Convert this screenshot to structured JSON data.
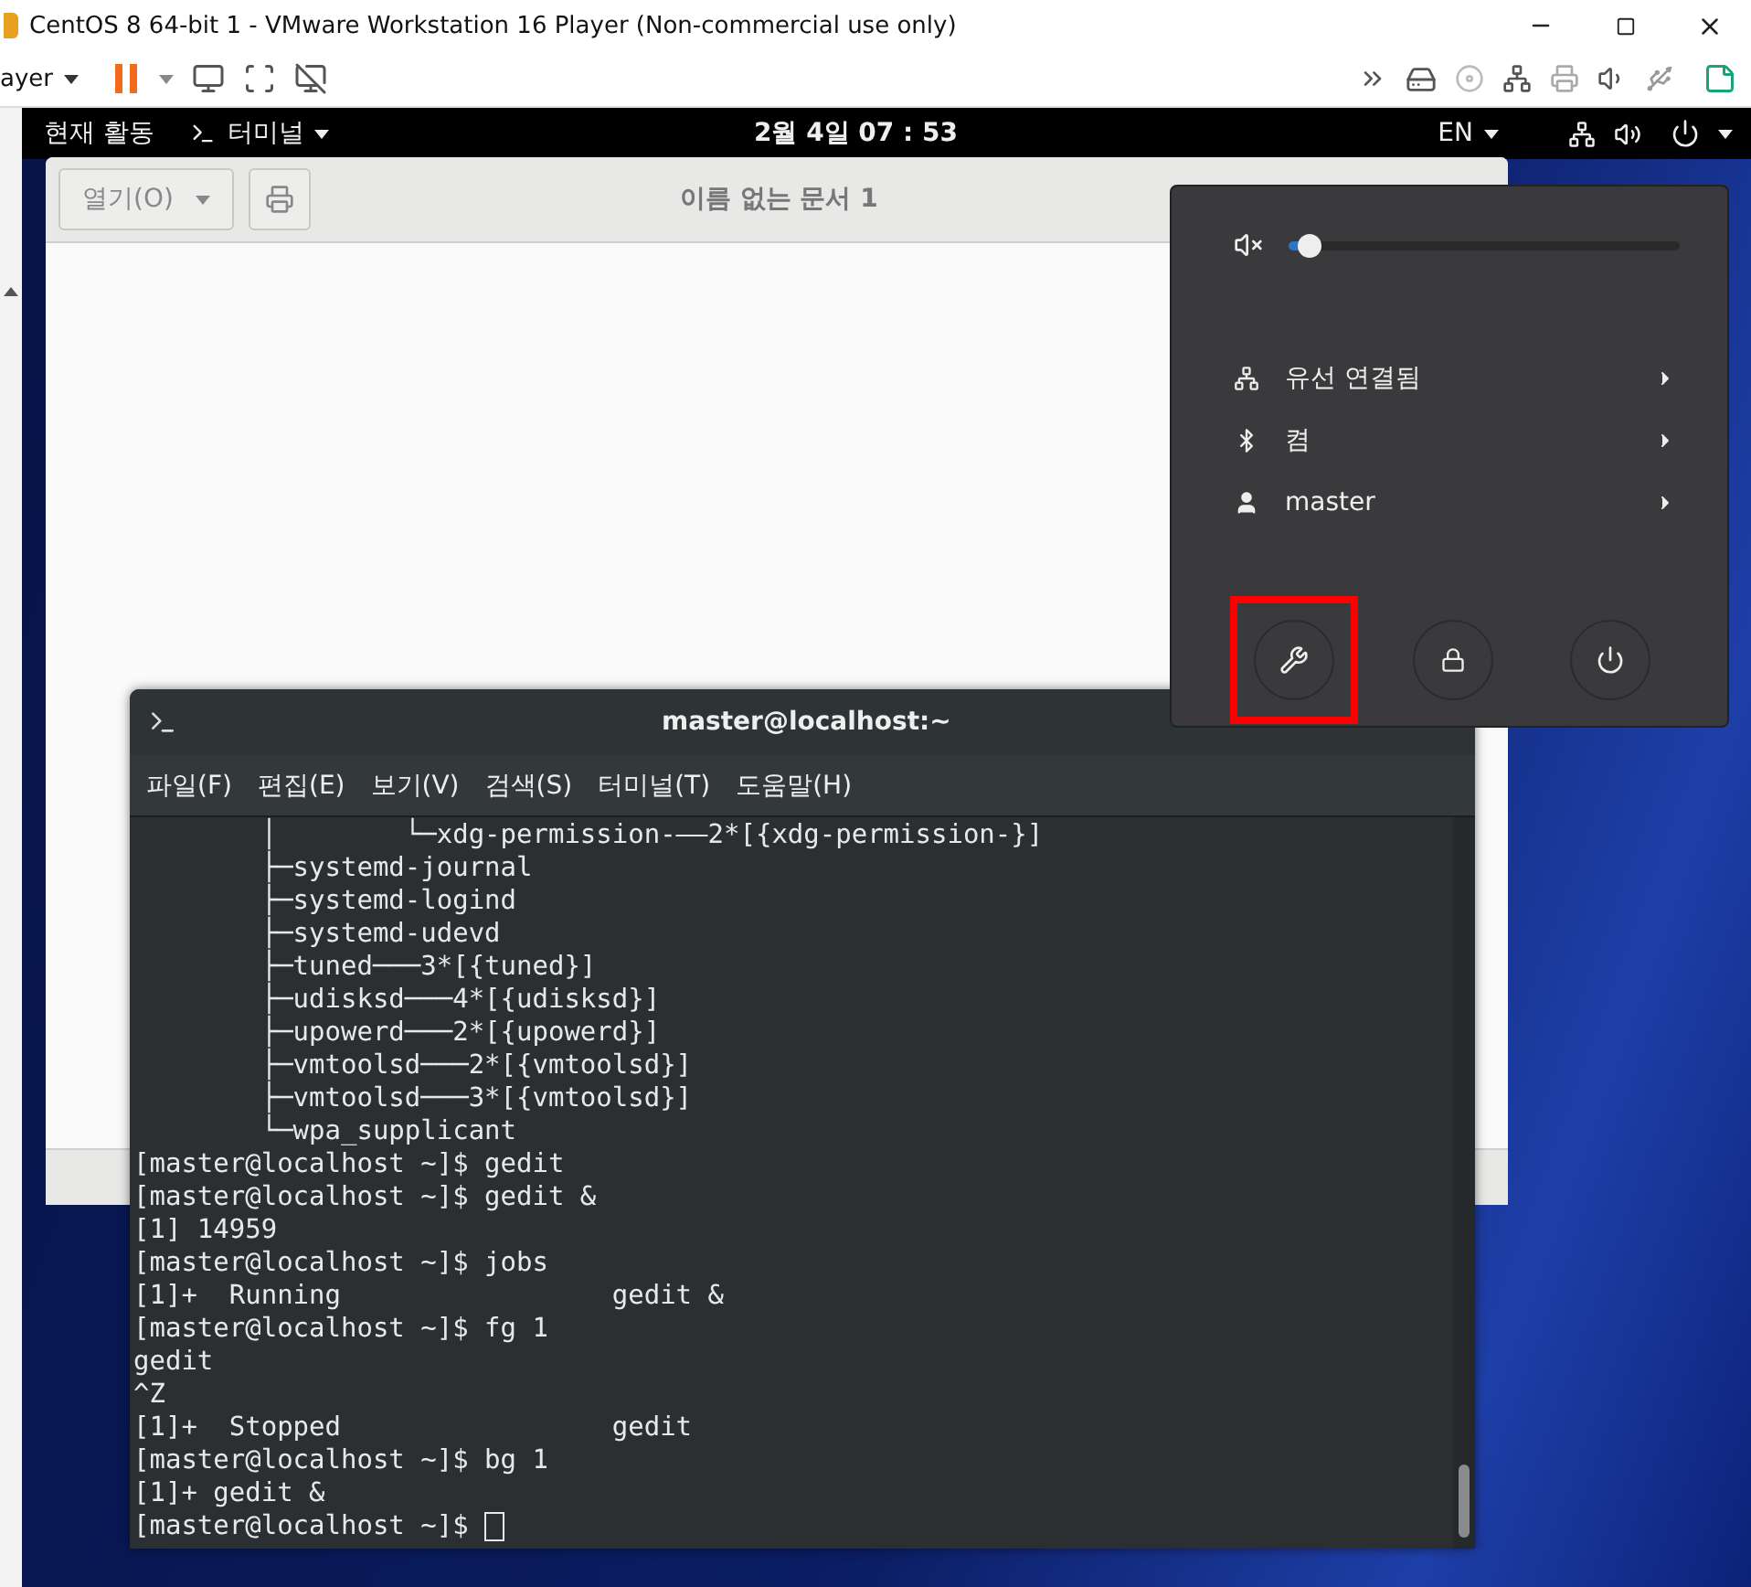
{
  "window": {
    "title": "CentOS 8 64-bit 1 - VMware Workstation 16 Player (Non-commercial use only)"
  },
  "vm_toolbar": {
    "menu_label": "ayer"
  },
  "top_bar": {
    "activities": "현재 활동",
    "app_menu": "터미널",
    "clock": "2월 4일  07 : 53",
    "input_source": "EN"
  },
  "gedit": {
    "open_button": "열기(O)",
    "title": "이름 없는 문서 1"
  },
  "system_menu": {
    "volume": {
      "level": 0.05
    },
    "items": [
      {
        "kind": "network",
        "label": "유선 연결됨"
      },
      {
        "kind": "bluetooth",
        "label": "켬"
      },
      {
        "kind": "user",
        "label": "master"
      }
    ],
    "buttons": [
      {
        "kind": "settings",
        "highlighted": true
      },
      {
        "kind": "lock",
        "highlighted": false
      },
      {
        "kind": "power",
        "highlighted": false
      }
    ]
  },
  "terminal": {
    "title": "master@localhost:~",
    "menu": [
      "파일(F)",
      "편집(E)",
      "보기(V)",
      "검색(S)",
      "터미널(T)",
      "도움말(H)"
    ],
    "lines": [
      "        │        └─xdg-permission-——2*[{xdg-permission-}]",
      "        ├─systemd-journal",
      "        ├─systemd-logind",
      "        ├─systemd-udevd",
      "        ├─tuned───3*[{tuned}]",
      "        ├─udisksd───4*[{udisksd}]",
      "        ├─upowerd───2*[{upowerd}]",
      "        ├─vmtoolsd───2*[{vmtoolsd}]",
      "        ├─vmtoolsd───3*[{vmtoolsd}]",
      "        └─wpa_supplicant",
      "[master@localhost ~]$ gedit",
      "[master@localhost ~]$ gedit &",
      "[1] 14959",
      "[master@localhost ~]$ jobs",
      "[1]+  Running                 gedit &",
      "[master@localhost ~]$ fg 1",
      "gedit",
      "^Z",
      "[1]+  Stopped                 gedit",
      "[master@localhost ~]$ bg 1",
      "[1]+ gedit &",
      "[master@localhost ~]$ "
    ]
  }
}
